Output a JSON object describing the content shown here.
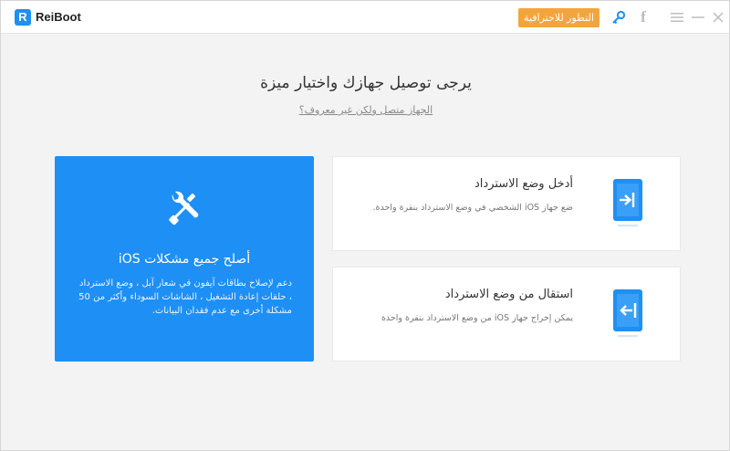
{
  "app": {
    "logo_letter": "R",
    "name": "ReiBoot"
  },
  "toolbar": {
    "pro_label": "التطور للاحترافية",
    "icons": [
      "key-icon",
      "facebook-icon",
      "menu-icon",
      "minimize-icon",
      "close-icon"
    ],
    "facebook_glyph": "f"
  },
  "main": {
    "heading": "يرجى توصيل جهازك واختيار ميزة",
    "subtext": "الجهاز متصل ولكن غير معروف؟"
  },
  "cards": {
    "fix_all": {
      "title": "أصلح جميع مشكلات iOS",
      "description": "دعم لإصلاح بطاقات آيفون في شعار آبل ، وضع الاسترداد ، حلقات إعادة التشغيل ، الشاشات السوداء وأكثر من 50 مشكلة أخرى مع عدم فقدان البيانات.",
      "icon": "tools-icon"
    },
    "enter_recovery": {
      "title": "أدخل وضع الاسترداد",
      "description": "ضع جهاز iOS الشخصي في وضع الاسترداد بنقرة واحدة.",
      "icon": "enter-recovery-icon"
    },
    "exit_recovery": {
      "title": "استقال من وضع الاسترداد",
      "description": "يمكن إخراج جهاز iOS من وضع الاسترداد بنقرة واحدة",
      "icon": "exit-recovery-icon"
    }
  },
  "colors": {
    "accent_blue": "#1e8ff5",
    "pro_orange": "#f3a53d",
    "background": "#f3f3f3"
  }
}
